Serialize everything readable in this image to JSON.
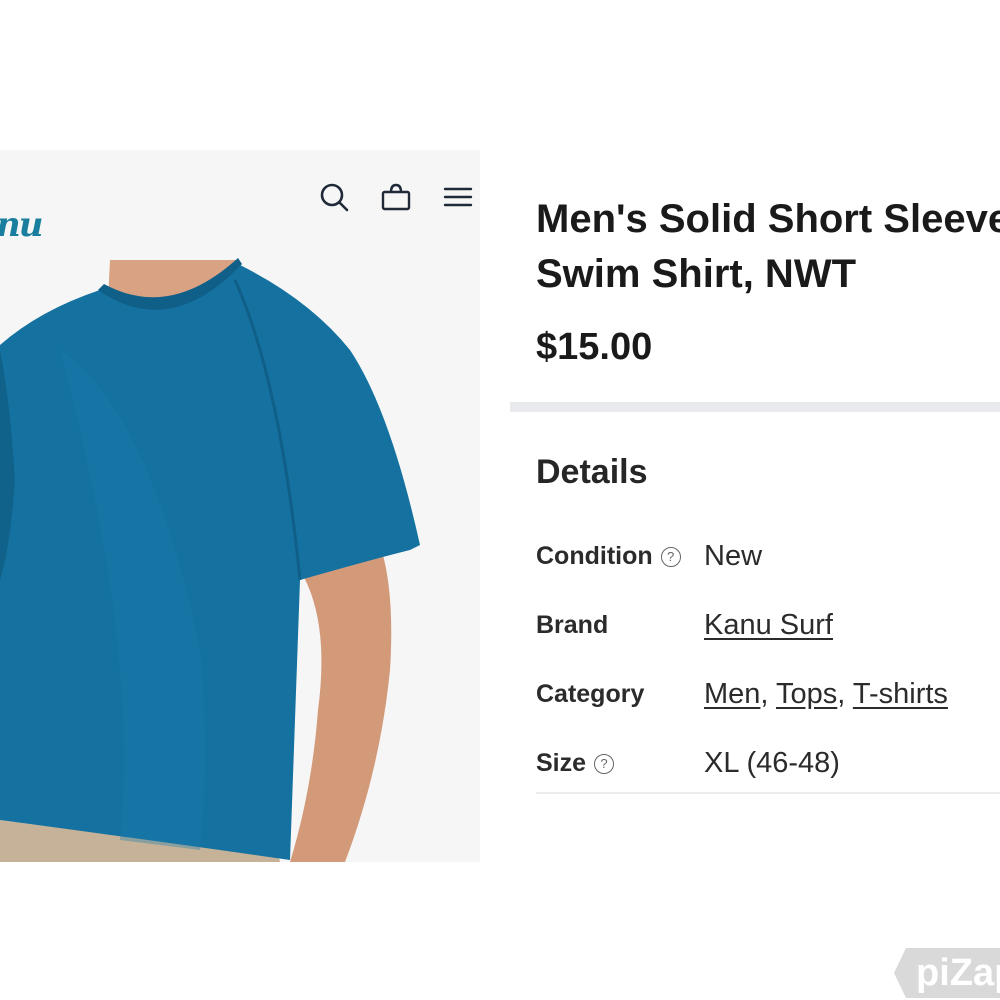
{
  "brand_logo_text": "nu",
  "header": {
    "icons": [
      "search-icon",
      "bag-icon",
      "menu-icon"
    ]
  },
  "product": {
    "title_line1": "Men's Solid Short Sleeve",
    "title_line2": "Swim Shirt, NWT",
    "price": "$15.00"
  },
  "details": {
    "heading": "Details",
    "rows": {
      "condition": {
        "label": "Condition",
        "value": "New"
      },
      "brand": {
        "label": "Brand",
        "value": "Kanu Surf"
      },
      "category": {
        "label": "Category",
        "values": [
          "Men",
          "Tops",
          "T-shirts"
        ]
      },
      "size": {
        "label": "Size",
        "value": "XL (46-48)"
      }
    }
  },
  "watermark": "piZap",
  "colors": {
    "shirt": "#1572a0",
    "logo": "#1a7f9e",
    "divider": "#e9eaee"
  }
}
